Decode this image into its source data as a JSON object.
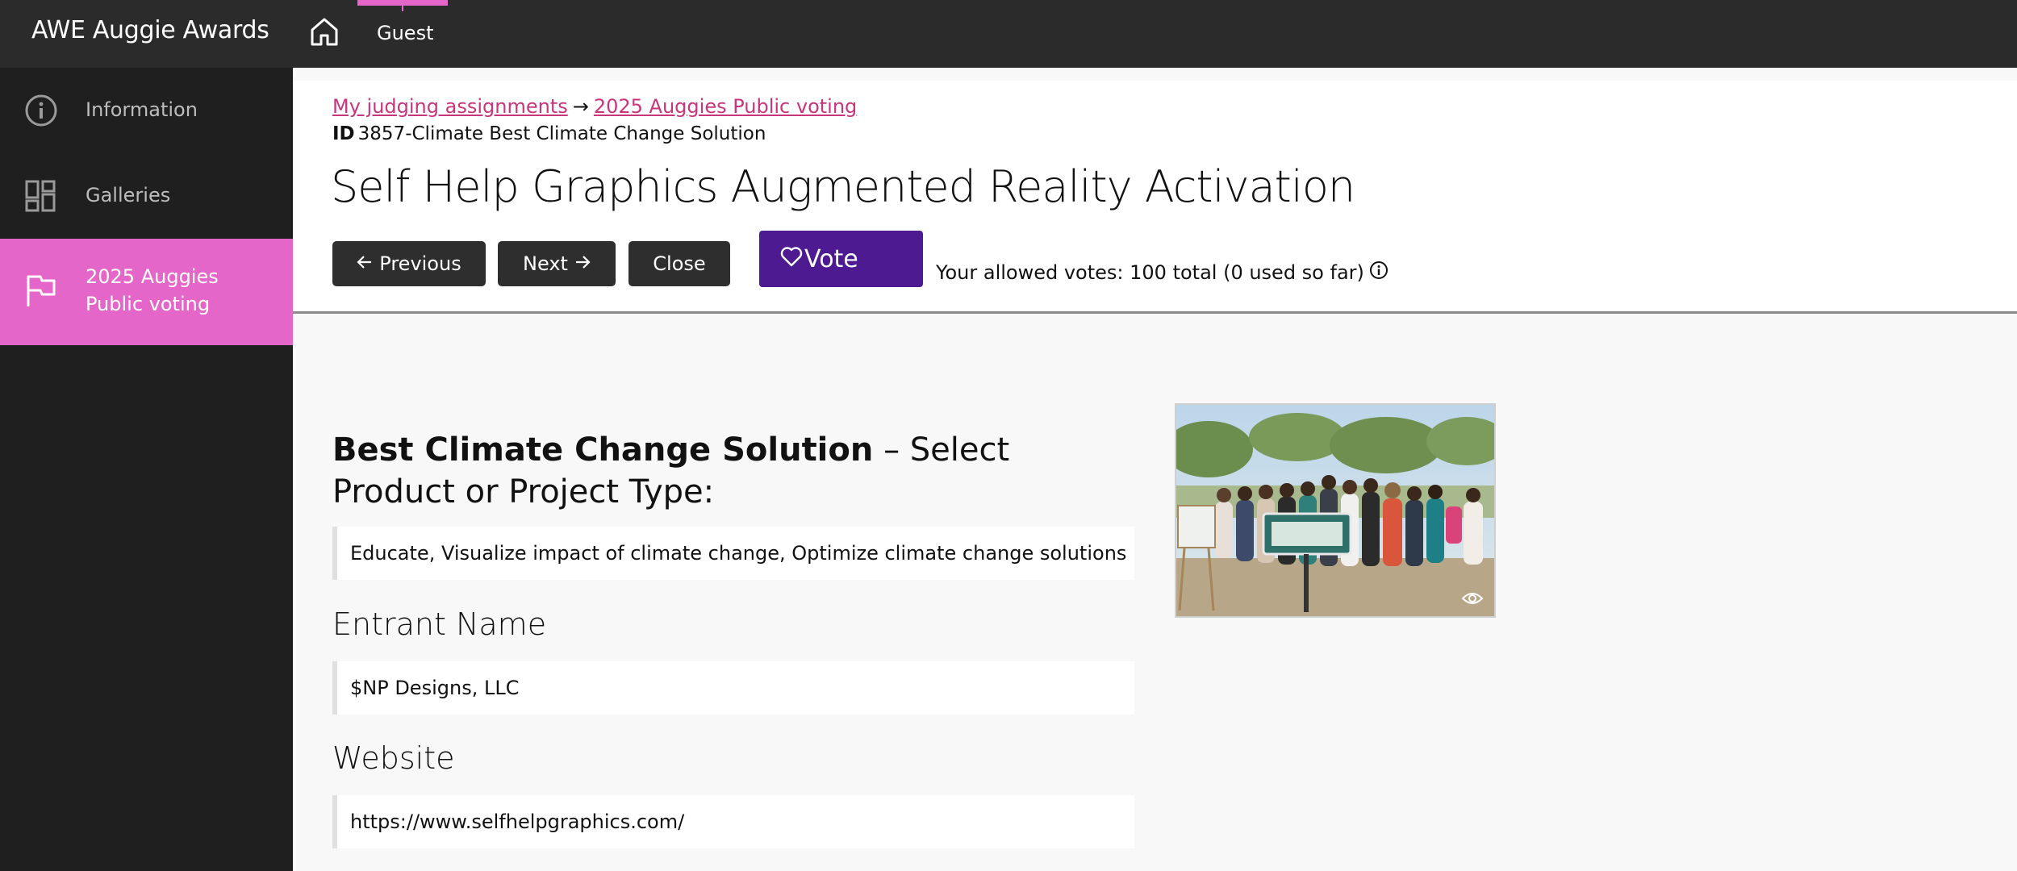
{
  "app": {
    "title": "AWE Auggie Awards"
  },
  "topnav": {
    "guest_label": "Guest"
  },
  "sidebar": {
    "items": [
      {
        "label": "Information",
        "icon": "info-icon"
      },
      {
        "label": "Galleries",
        "icon": "galleries-icon"
      },
      {
        "label": "2025 Auggies Public voting",
        "icon": "flag-icon",
        "active": true
      }
    ]
  },
  "breadcrumb": {
    "link1": "My judging assignments",
    "separator": "→",
    "link2": "2025 Auggies Public voting"
  },
  "entry": {
    "id_label": "ID",
    "id_value": "3857-Climate Best Climate Change Solution",
    "title": "Self Help Graphics Augmented Reality Activation"
  },
  "actions": {
    "previous_label": "Previous",
    "next_label": "Next",
    "close_label": "Close",
    "vote_label": "Vote",
    "votes_info": "Your allowed votes: 100 total (0 used so far)"
  },
  "fields": {
    "category_bold": "Best Climate Change Solution",
    "category_rest": " – Select Product or Project Type:",
    "category_value": "Educate, Visualize impact of climate change, Optimize climate change solutions",
    "entrant_label": "Entrant Name",
    "entrant_value": "$NP Designs, LLC",
    "website_label": "Website",
    "website_value": "https://www.selfhelpgraphics.com/"
  },
  "colors": {
    "accent_pink": "#e466c9",
    "vote_purple": "#4e1a92",
    "link": "#c9357b",
    "topbar": "#2b2b2b",
    "sidebar": "#1f1f1f"
  }
}
